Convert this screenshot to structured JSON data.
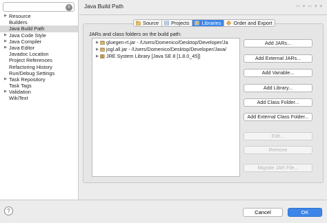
{
  "search": {
    "value": "",
    "placeholder": ""
  },
  "sidebar": {
    "items": [
      {
        "label": "Resource",
        "expandable": true
      },
      {
        "label": "Builders",
        "expandable": false
      },
      {
        "label": "Java Build Path",
        "expandable": false,
        "selected": true
      },
      {
        "label": "Java Code Style",
        "expandable": true
      },
      {
        "label": "Java Compiler",
        "expandable": true
      },
      {
        "label": "Java Editor",
        "expandable": true
      },
      {
        "label": "Javadoc Location",
        "expandable": false
      },
      {
        "label": "Project References",
        "expandable": false
      },
      {
        "label": "Refactoring History",
        "expandable": false
      },
      {
        "label": "Run/Debug Settings",
        "expandable": false
      },
      {
        "label": "Task Repository",
        "expandable": true
      },
      {
        "label": "Task Tags",
        "expandable": false
      },
      {
        "label": "Validation",
        "expandable": true
      },
      {
        "label": "WikiText",
        "expandable": false
      }
    ]
  },
  "header": {
    "title": "Java Build Path",
    "nav_arrows": "⇦ ▾ ⇨ ▾ ▾"
  },
  "tabs": [
    {
      "label": "Source",
      "active": false
    },
    {
      "label": "Projects",
      "active": false
    },
    {
      "label": "Libraries",
      "active": true
    },
    {
      "label": "Order and Export",
      "active": false
    }
  ],
  "libraries": {
    "label": "JARs and class folders on the build path:",
    "items": [
      {
        "label": "gluegen-rt.jar - /Users/Domenico/Desktop/Developer/Ja"
      },
      {
        "label": "jogl.all.jar - /Users/Domenico/Desktop/Developer/Java/"
      },
      {
        "label": "JRE System Library [Java SE 8 [1.8.0_45]]"
      }
    ]
  },
  "buttons": {
    "add_jars": "Add JARs...",
    "add_external_jars": "Add External JARs...",
    "add_variable": "Add Variable...",
    "add_library": "Add Library...",
    "add_class_folder": "Add Class Folder...",
    "add_external_class_folder": "Add External Class Folder...",
    "edit": "Edit...",
    "remove": "Remove",
    "migrate_jar": "Migrate JAR File..."
  },
  "footer": {
    "help": "?",
    "cancel": "Cancel",
    "ok": "OK"
  },
  "colors": {
    "accent": "#3d86e8",
    "selection": "#d9d9d9"
  }
}
